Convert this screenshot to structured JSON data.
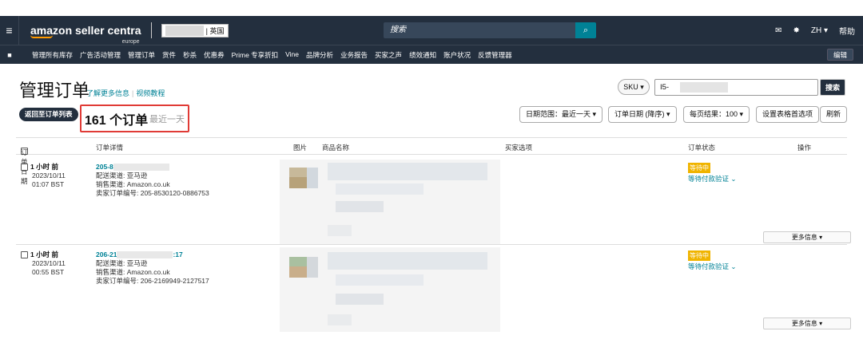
{
  "header": {
    "logo_main": "amazon seller centra",
    "logo_sub": "europe",
    "marketplace": "| 英国",
    "search_placeholder": "搜索",
    "lang": "ZH ▾",
    "help": "帮助"
  },
  "nav": {
    "items": [
      "管理所有库存",
      "广告活动管理",
      "管理订单",
      "货件",
      "秒杀",
      "优惠券",
      "Prime 专享折扣",
      "Vine",
      "品牌分析",
      "业务报告",
      "买家之声",
      "绩效通知",
      "账户状况",
      "反馈管理器"
    ],
    "edit": "编辑"
  },
  "page": {
    "title": "管理订单",
    "learn_more": "了解更多信息",
    "video": "视频教程",
    "back": "返回至订单列表",
    "count": "161 个订单",
    "count_sub": "最近一天",
    "sku_select": "SKU ▾",
    "sku_value": "I5-",
    "search_btn": "搜索",
    "date_range": "日期范围：最近一天 ▾",
    "order_date": "订单日期 (降序) ▾",
    "per_page": "每页结果：100 ▾",
    "table_prefs": "设置表格首选项",
    "refresh": "刷新"
  },
  "columns": [
    "订单日期",
    "订单详情",
    "图片",
    "商品名称",
    "买家选项",
    "订单状态",
    "操作"
  ],
  "orders": [
    {
      "age": "1 小时 前",
      "date": "2023/10/11",
      "time": "01:07 BST",
      "order_id": "205-8",
      "channel": "配送渠道: 亚马逊",
      "sales": "销售渠道: Amazon.co.uk",
      "seller_id": "卖家订单编号: 205-8530120-0886753",
      "badge": "等待中",
      "status": "等待付款验证 ⌄",
      "more": "更多信息 ▾"
    },
    {
      "age": "1 小时 前",
      "date": "2023/10/11",
      "time": "00:55 BST",
      "order_id": "206-21",
      "order_id_tail": ":17",
      "channel": "配送渠道: 亚马逊",
      "sales": "销售渠道: Amazon.co.uk",
      "seller_id": "卖家订单编号: 206-2169949-2127517",
      "badge": "等待中",
      "status": "等待付款验证 ⌄",
      "more": "更多信息 ▾"
    }
  ]
}
